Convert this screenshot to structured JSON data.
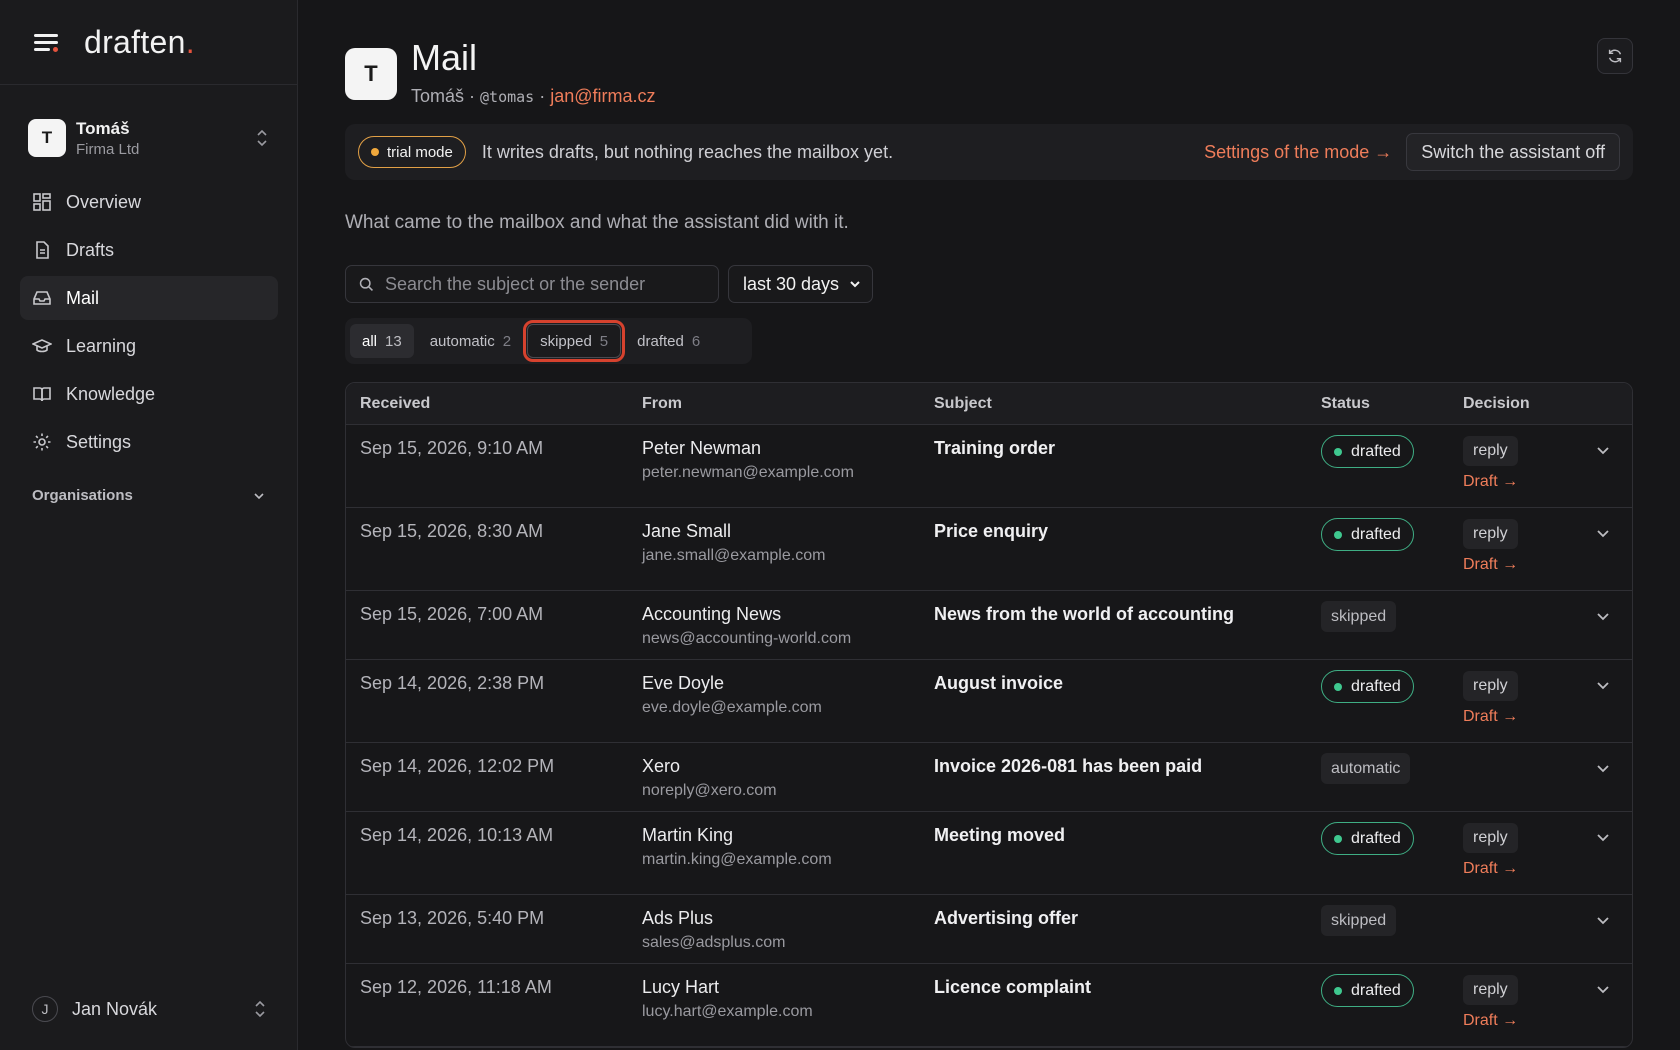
{
  "brand": {
    "logo_text": "draften",
    "logo_dot": "."
  },
  "org_switch": {
    "avatar": "T",
    "name": "Tomáš",
    "sub": "Firma Ltd"
  },
  "nav": [
    {
      "label": "Overview",
      "icon": "grid-icon"
    },
    {
      "label": "Drafts",
      "icon": "document-icon"
    },
    {
      "label": "Mail",
      "icon": "inbox-icon",
      "active": true
    },
    {
      "label": "Learning",
      "icon": "graduation-cap-icon"
    },
    {
      "label": "Knowledge",
      "icon": "book-icon"
    },
    {
      "label": "Settings",
      "icon": "gear-icon"
    }
  ],
  "organisations_label": "Organisations",
  "user": {
    "avatar": "J",
    "name": "Jan Novák"
  },
  "page": {
    "avatar": "T",
    "title": "Mail",
    "sub_name": "Tomáš · ",
    "sub_handle": "@tomas",
    "sub_sep": " · ",
    "sub_email": "jan@firma.cz"
  },
  "banner": {
    "pill": "trial mode",
    "text": "It writes drafts, but nothing reaches the mailbox yet.",
    "link": "Settings of the mode →",
    "button": "Switch the assistant off"
  },
  "intro": "What came to the mailbox and what the assistant did with it.",
  "search": {
    "placeholder": "Search the subject or the sender",
    "value": ""
  },
  "range": {
    "selected": "last 30 days"
  },
  "filters": [
    {
      "label": "all",
      "count": "13"
    },
    {
      "label": "automatic",
      "count": "2"
    },
    {
      "label": "skipped",
      "count": "5"
    },
    {
      "label": "drafted",
      "count": "6"
    }
  ],
  "table": {
    "headers": {
      "received": "Received",
      "from": "From",
      "subject": "Subject",
      "status": "Status",
      "decision": "Decision"
    },
    "rows": [
      {
        "received": "Sep 15, 2026, 9:10 AM",
        "name": "Peter Newman",
        "email": "peter.newman@example.com",
        "subject": "Training order",
        "status": "drafted",
        "decision": "reply",
        "link": "Draft →"
      },
      {
        "received": "Sep 15, 2026, 8:30 AM",
        "name": "Jane Small",
        "email": "jane.small@example.com",
        "subject": "Price enquiry",
        "status": "drafted",
        "decision": "reply",
        "link": "Draft →"
      },
      {
        "received": "Sep 15, 2026, 7:00 AM",
        "name": "Accounting News",
        "email": "news@accounting-world.com",
        "subject": "News from the world of accounting",
        "status": "skipped"
      },
      {
        "received": "Sep 14, 2026, 2:38 PM",
        "name": "Eve Doyle",
        "email": "eve.doyle@example.com",
        "subject": "August invoice",
        "status": "drafted",
        "decision": "reply",
        "link": "Draft →"
      },
      {
        "received": "Sep 14, 2026, 12:02 PM",
        "name": "Xero",
        "email": "noreply@xero.com",
        "subject": "Invoice 2026-081 has been paid",
        "status": "automatic"
      },
      {
        "received": "Sep 14, 2026, 10:13 AM",
        "name": "Martin King",
        "email": "martin.king@example.com",
        "subject": "Meeting moved",
        "status": "drafted",
        "decision": "reply",
        "link": "Draft →"
      },
      {
        "received": "Sep 13, 2026, 5:40 PM",
        "name": "Ads Plus",
        "email": "sales@adsplus.com",
        "subject": "Advertising offer",
        "status": "skipped"
      },
      {
        "received": "Sep 12, 2026, 11:18 AM",
        "name": "Lucy Hart",
        "email": "lucy.hart@example.com",
        "subject": "Licence complaint",
        "status": "drafted",
        "decision": "reply",
        "link": "Draft →"
      }
    ]
  },
  "colors": {
    "accent": "#ef7d5a",
    "brand_dot": "#e5533d",
    "drafted": "#3fc88f",
    "trial": "#f0a83c",
    "focus_ring": "#d6422e"
  }
}
